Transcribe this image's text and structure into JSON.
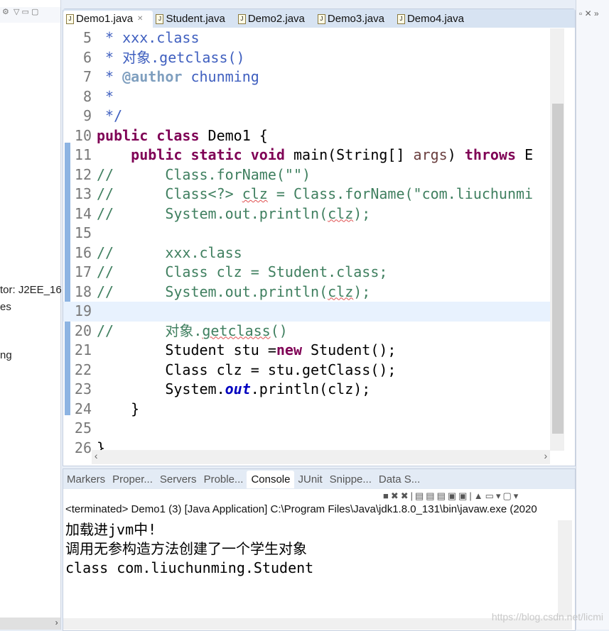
{
  "left_panel": {
    "fragments": [
      "tor: J2EE_16",
      "es",
      "ng"
    ]
  },
  "editor": {
    "tabs": [
      {
        "label": "Demo1.java",
        "active": true
      },
      {
        "label": "Student.java"
      },
      {
        "label": "Demo2.java"
      },
      {
        "label": "Demo3.java"
      },
      {
        "label": "Demo4.java"
      }
    ],
    "current_line": 19,
    "lines": [
      {
        "n": "5",
        "tokens": [
          {
            "t": " * xxx.class",
            "c": "jd"
          }
        ]
      },
      {
        "n": "6",
        "tokens": [
          {
            "t": " * 对象.getclass()",
            "c": "jd"
          }
        ]
      },
      {
        "n": "7",
        "tokens": [
          {
            "t": " * ",
            "c": "jd"
          },
          {
            "t": "@author",
            "c": "jdtag"
          },
          {
            "t": " chunming",
            "c": "jd"
          }
        ]
      },
      {
        "n": "8",
        "tokens": [
          {
            "t": " *",
            "c": "jd"
          }
        ]
      },
      {
        "n": "9",
        "tokens": [
          {
            "t": " */",
            "c": "jd"
          }
        ]
      },
      {
        "n": "10",
        "tokens": [
          {
            "t": "public class",
            "c": "kw"
          },
          {
            "t": " Demo1 {",
            "c": "pl"
          }
        ]
      },
      {
        "n": "11",
        "tokens": [
          {
            "t": "    ",
            "c": "pl"
          },
          {
            "t": "public static void",
            "c": "kw"
          },
          {
            "t": " main(String[] ",
            "c": "pl"
          },
          {
            "t": "args",
            "c": "var"
          },
          {
            "t": ") ",
            "c": "pl"
          },
          {
            "t": "throws",
            "c": "kw"
          },
          {
            "t": " E",
            "c": "pl"
          }
        ]
      },
      {
        "n": "12",
        "tokens": [
          {
            "t": "//      Class.forName(\"\")",
            "c": "cm"
          }
        ]
      },
      {
        "n": "13",
        "tokens": [
          {
            "t": "//      Class<?> ",
            "c": "cm"
          },
          {
            "t": "clz",
            "c": "cm sq"
          },
          {
            "t": " = Class.forName(\"com.liuchunmi",
            "c": "cm"
          }
        ]
      },
      {
        "n": "14",
        "tokens": [
          {
            "t": "//      System.out.println(",
            "c": "cm"
          },
          {
            "t": "clz",
            "c": "cm sq"
          },
          {
            "t": ");",
            "c": "cm"
          }
        ]
      },
      {
        "n": "15",
        "tokens": []
      },
      {
        "n": "16",
        "tokens": [
          {
            "t": "//      xxx.class",
            "c": "cm"
          }
        ]
      },
      {
        "n": "17",
        "tokens": [
          {
            "t": "//      Class clz = Student.class;",
            "c": "cm"
          }
        ]
      },
      {
        "n": "18",
        "tokens": [
          {
            "t": "//      System.out.println(",
            "c": "cm"
          },
          {
            "t": "clz",
            "c": "cm sq"
          },
          {
            "t": ");",
            "c": "cm"
          }
        ]
      },
      {
        "n": "19",
        "tokens": []
      },
      {
        "n": "20",
        "tokens": [
          {
            "t": "//      对象.",
            "c": "cm"
          },
          {
            "t": "getclass",
            "c": "cm sq"
          },
          {
            "t": "()",
            "c": "cm"
          }
        ]
      },
      {
        "n": "21",
        "tokens": [
          {
            "t": "        Student stu =",
            "c": "pl"
          },
          {
            "t": "new",
            "c": "kw"
          },
          {
            "t": " Student();",
            "c": "pl"
          }
        ]
      },
      {
        "n": "22",
        "tokens": [
          {
            "t": "        Class clz = stu.getClass();",
            "c": "pl"
          }
        ]
      },
      {
        "n": "23",
        "tokens": [
          {
            "t": "        System.",
            "c": "pl"
          },
          {
            "t": "out",
            "c": "fld"
          },
          {
            "t": ".println(clz);",
            "c": "pl"
          }
        ]
      },
      {
        "n": "24",
        "tokens": [
          {
            "t": "    }",
            "c": "pl"
          }
        ]
      },
      {
        "n": "25",
        "tokens": []
      },
      {
        "n": "26",
        "tokens": [
          {
            "t": "}",
            "c": "pl"
          }
        ]
      }
    ]
  },
  "console": {
    "tabs": [
      {
        "label": "Markers"
      },
      {
        "label": "Proper..."
      },
      {
        "label": "Servers"
      },
      {
        "label": "Proble..."
      },
      {
        "label": "Console",
        "active": true
      },
      {
        "label": "JUnit"
      },
      {
        "label": "Snippe..."
      },
      {
        "label": "Data S..."
      }
    ],
    "status": "<terminated> Demo1 (3) [Java Application] C:\\Program Files\\Java\\jdk1.8.0_131\\bin\\javaw.exe (2020",
    "output": [
      "加载进jvm中!",
      "调用无参构造方法创建了一个学生对象",
      "class com.liuchunming.Student"
    ]
  },
  "watermark": "https://blog.csdn.net/licmi"
}
